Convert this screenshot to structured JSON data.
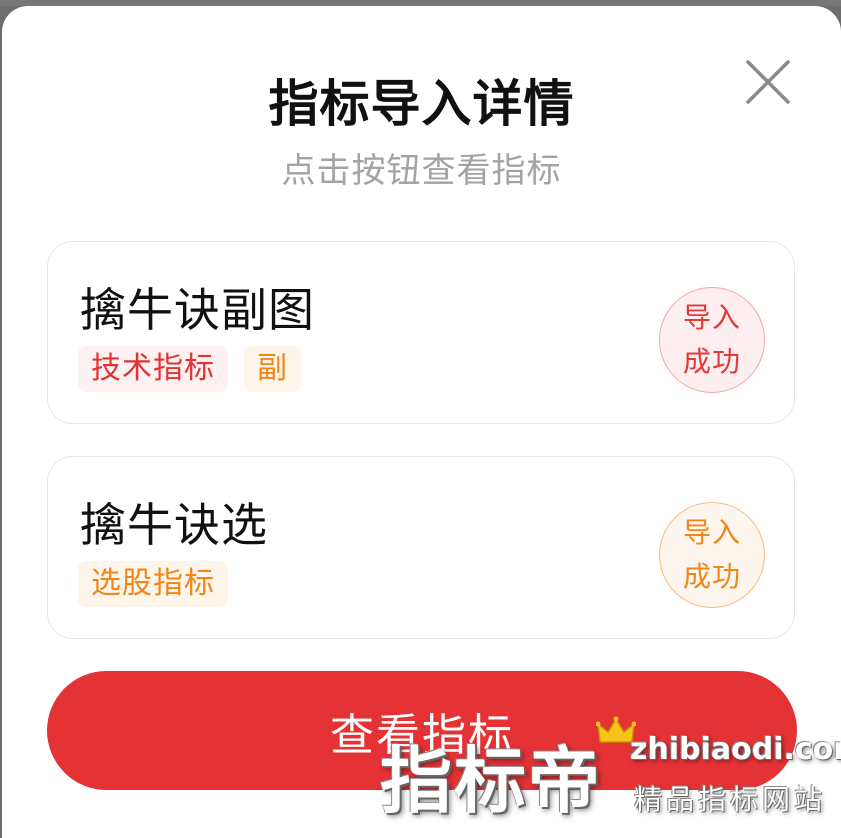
{
  "dialog": {
    "title": "指标导入详情",
    "subtitle": "点击按钮查看指标",
    "close_icon": "close-icon"
  },
  "indicators": [
    {
      "name": "擒牛诀副图",
      "tags": [
        "技术指标",
        "副"
      ],
      "status": [
        "导入",
        "成功"
      ],
      "status_color": "#e23a3a"
    },
    {
      "name": "擒牛诀选",
      "tags": [
        "选股指标"
      ],
      "status": [
        "导入",
        "成功"
      ],
      "status_color": "#ef8619"
    }
  ],
  "cta": {
    "label": "查看指标",
    "color": "#e53235"
  },
  "watermark": {
    "brand": "指标帝",
    "domain": "zhibiaodi.com",
    "slogan": "精品指标网站"
  }
}
